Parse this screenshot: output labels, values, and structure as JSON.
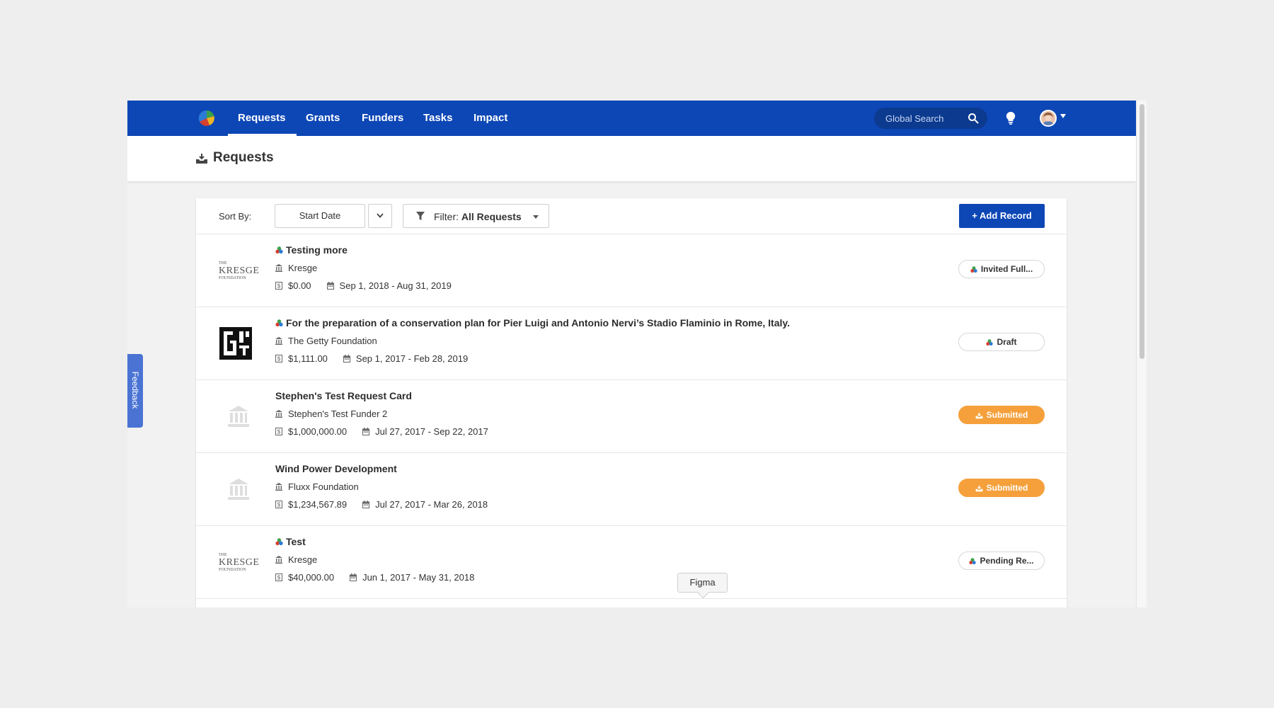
{
  "nav": {
    "logo": "app-logo",
    "links": [
      "Requests",
      "Grants",
      "Funders",
      "Tasks",
      "Impact"
    ],
    "active": "Requests",
    "search_placeholder": "Global Search"
  },
  "page": {
    "title": "Requests",
    "icon": "requests-icon"
  },
  "feedback": {
    "label": "Feedback"
  },
  "toolbar": {
    "sort_label": "Sort By:",
    "sort_value": "Start Date",
    "filter_prefix": "Filter:",
    "filter_value": "All Requests",
    "add_label": "+ Add Record"
  },
  "requests": [
    {
      "title": "Testing more",
      "has_app_icon": true,
      "funder": "Kresge",
      "amount": "$0.00",
      "dates": "Sep 1, 2018 - Aug 31, 2019",
      "logo": "kresge-foundation-logo",
      "logo_text": {
        "top": "THE",
        "main": "KRESGE",
        "bottom": "FOUNDATION"
      },
      "status": "Invited Full...",
      "status_style": "outline"
    },
    {
      "title": "For the preparation of a conservation plan for Pier Luigi and Antonio Nervi’s Stadio Flaminio in Rome, Italy.",
      "has_app_icon": true,
      "funder": "The Getty Foundation",
      "amount": "$1,111.00",
      "dates": "Sep 1, 2017 - Feb 28, 2019",
      "logo": "getty-logo",
      "status": "Draft",
      "status_style": "outline"
    },
    {
      "title": "Stephen's Test Request Card",
      "has_app_icon": false,
      "funder": "Stephen's Test Funder 2",
      "amount": "$1,000,000.00",
      "dates": "Jul 27, 2017 - Sep 22, 2017",
      "logo": "institution-placeholder-icon",
      "status": "Submitted",
      "status_style": "orange"
    },
    {
      "title": "Wind Power Development",
      "has_app_icon": false,
      "funder": "Fluxx Foundation",
      "amount": "$1,234,567.89",
      "dates": "Jul 27, 2017 - Mar 26, 2018",
      "logo": "institution-placeholder-icon",
      "status": "Submitted",
      "status_style": "orange"
    },
    {
      "title": "Test",
      "has_app_icon": true,
      "funder": "Kresge",
      "amount": "$40,000.00",
      "dates": "Jun 1, 2017 - May 31, 2018",
      "logo": "kresge-foundation-logo",
      "logo_text": {
        "top": "THE",
        "main": "KRESGE",
        "bottom": "FOUNDATION"
      },
      "status": "Pending Re...",
      "status_style": "outline"
    }
  ],
  "tooltip": {
    "label": "Figma"
  },
  "colors": {
    "nav_blue": "#0d47b6",
    "submitted_orange": "#f5a03b",
    "feedback_blue": "#4a73d4"
  }
}
